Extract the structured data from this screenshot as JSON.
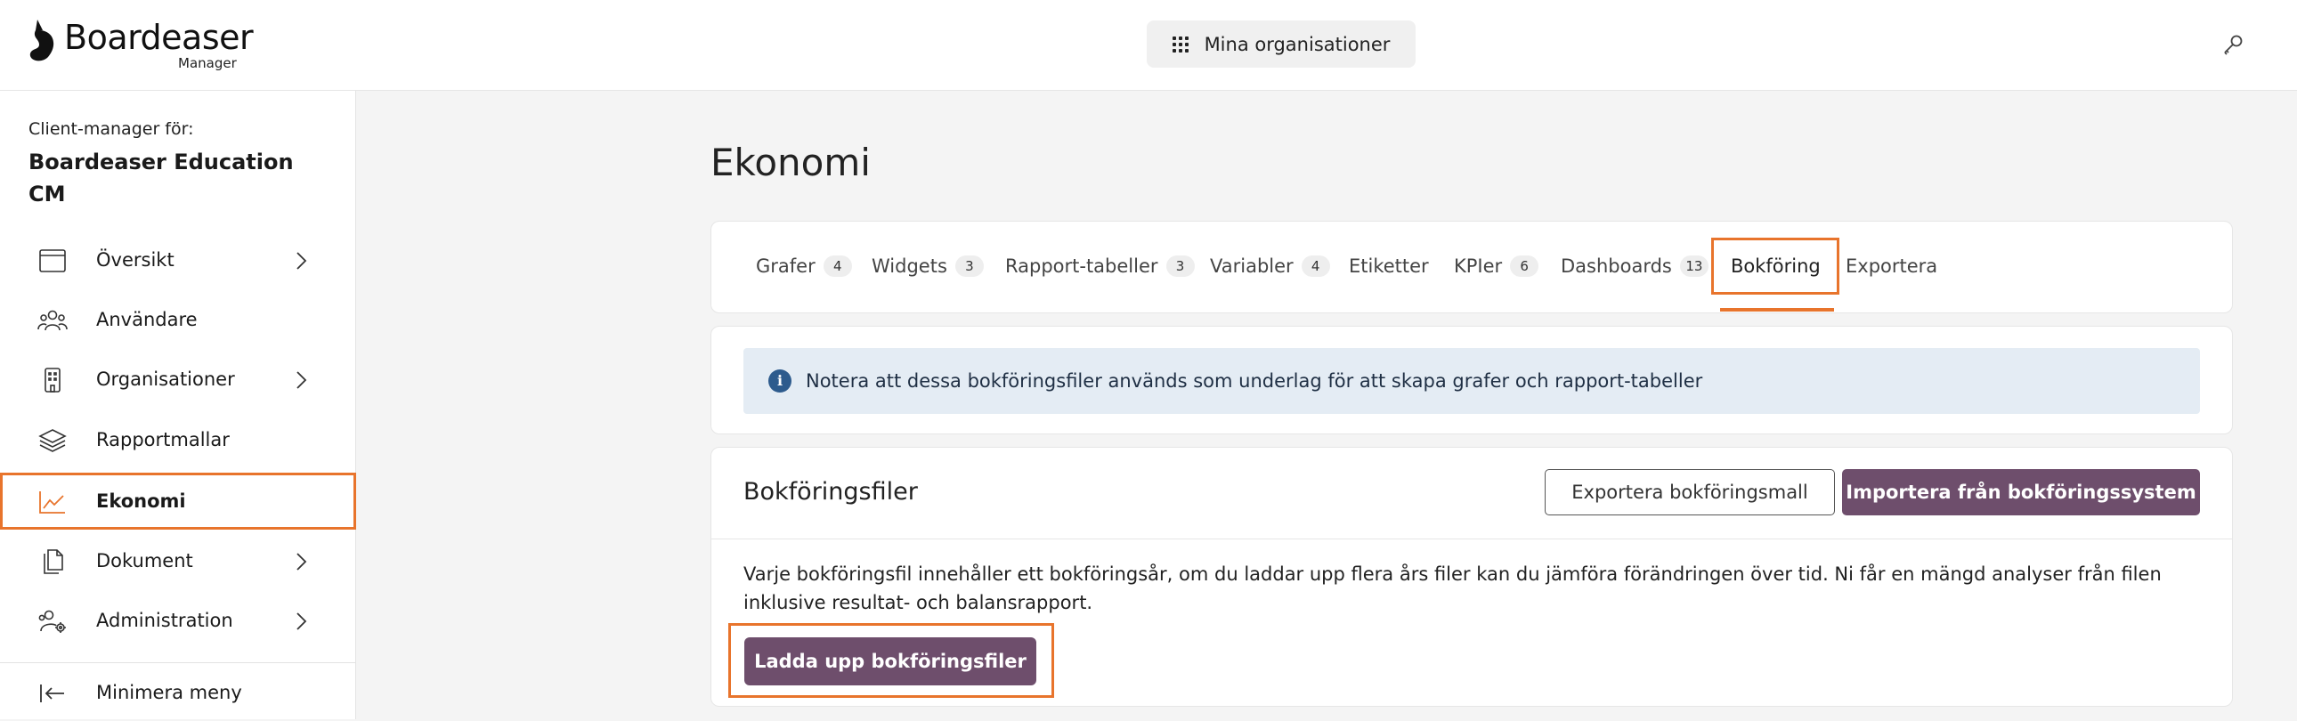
{
  "header": {
    "logo_text": "Boardeaser",
    "logo_sub": "Manager",
    "org_button_label": "Mina organisationer"
  },
  "sidebar": {
    "subtitle": "Client-manager för:",
    "client_name": "Boardeaser Education CM",
    "items": [
      {
        "label": "Översikt",
        "icon": "browser-window-icon",
        "has_chevron": true
      },
      {
        "label": "Användare",
        "icon": "users-icon",
        "has_chevron": false
      },
      {
        "label": "Organisationer",
        "icon": "building-icon",
        "has_chevron": true
      },
      {
        "label": "Rapportmallar",
        "icon": "layers-icon",
        "has_chevron": false
      },
      {
        "label": "Ekonomi",
        "icon": "line-chart-icon",
        "has_chevron": false,
        "active": true
      },
      {
        "label": "Dokument",
        "icon": "documents-icon",
        "has_chevron": true
      },
      {
        "label": "Administration",
        "icon": "users-gear-icon",
        "has_chevron": true
      }
    ],
    "minimize_label": "Minimera meny"
  },
  "main": {
    "title": "Ekonomi",
    "tabs": [
      {
        "label": "Grafer",
        "count": "4"
      },
      {
        "label": "Widgets",
        "count": "3"
      },
      {
        "label": "Rapport-tabeller",
        "count": "3"
      },
      {
        "label": "Variabler",
        "count": "4"
      },
      {
        "label": "Etiketter",
        "count": ""
      },
      {
        "label": "KPIer",
        "count": "6"
      },
      {
        "label": "Dashboards",
        "count": "13"
      },
      {
        "label": "Bokföring",
        "count": "",
        "active": true
      },
      {
        "label": "Exportera",
        "count": ""
      }
    ],
    "info_text": "Notera att dessa bokföringsfiler används som underlag för att skapa grafer och rapport-tabeller",
    "files": {
      "title": "Bokföringsfiler",
      "export_template_label": "Exportera bokföringsmall",
      "import_label": "Importera från bokföringssystem",
      "description": "Varje bokföringsfil innehåller ett bokföringsår, om du laddar upp flera års filer kan du jämföra förändringen över tid. Ni får en mängd analyser från filen inklusive resultat- och balansrapport.",
      "upload_label": "Ladda upp bokföringsfiler"
    }
  },
  "colors": {
    "accent_orange": "#e8742c",
    "primary_plum": "#6e4e6c",
    "info_bg": "#e4ecf4"
  }
}
